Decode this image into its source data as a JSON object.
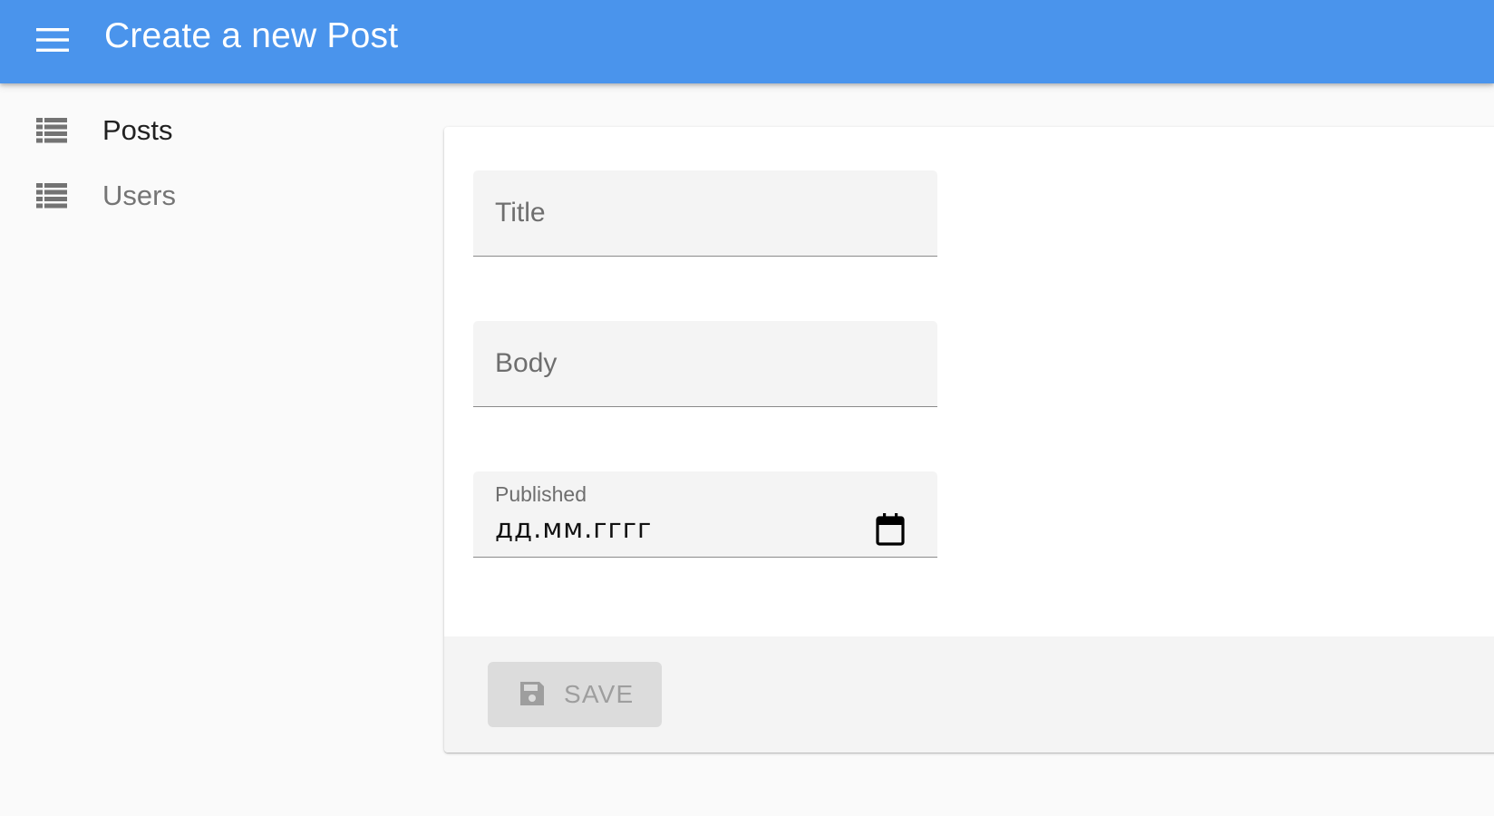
{
  "appbar": {
    "title": "Create a new Post",
    "menu_icon": "hamburger-menu-icon",
    "background": "#4a94ec"
  },
  "sidebar": {
    "items": [
      {
        "label": "Posts",
        "icon": "list-icon",
        "active": true
      },
      {
        "label": "Users",
        "icon": "list-icon",
        "active": false
      }
    ]
  },
  "form": {
    "title_field": {
      "placeholder": "Title",
      "value": ""
    },
    "body_field": {
      "placeholder": "Body",
      "value": ""
    },
    "published_field": {
      "label": "Published",
      "value": "дд.мм.гггг",
      "icon": "calendar-icon"
    }
  },
  "toolbar": {
    "save_label": "SAVE",
    "save_icon": "floppy-disk-icon",
    "save_disabled": true
  }
}
